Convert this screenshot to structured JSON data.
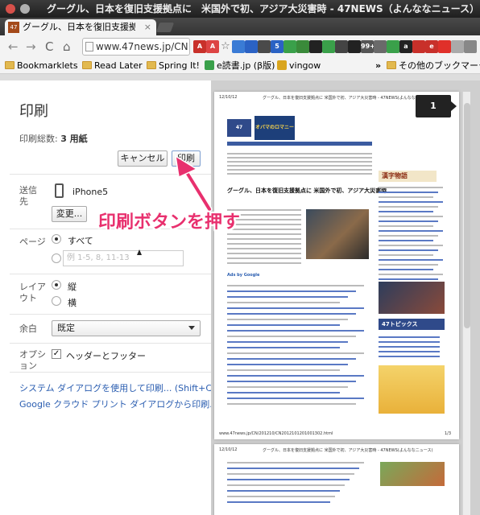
{
  "window": {
    "title": "グーグル、日本を復旧支援拠点に　米国外で初、アジア大災害時 - 47NEWS（よんななニュース）"
  },
  "tab": {
    "favicon": "47",
    "title": "グーグル、日本を復旧支援拠",
    "close": "×"
  },
  "toolbar": {
    "back": "←",
    "forward": "→",
    "reload": "C",
    "home": "⌂",
    "url": "www.47news.jp/CN",
    "extensions": [
      "A",
      "A",
      "☆",
      "",
      "",
      "",
      "5",
      "",
      "",
      "",
      "",
      "",
      "",
      "99+",
      "",
      "",
      "a",
      "",
      "e",
      "",
      "",
      "",
      "⚡"
    ]
  },
  "bookmarks": {
    "items": [
      "Bookmarklets",
      "Read Later",
      "Spring It!",
      "e読書.jp (β版)",
      "vingow"
    ],
    "more": "»",
    "other": "その他のブックマーク"
  },
  "print": {
    "title": "印刷",
    "total_label": "印刷総数: ",
    "total_value": "3 用紙",
    "cancel": "キャンセル",
    "print": "印刷",
    "destination_label": "送信先",
    "destination_name": "iPhone5",
    "change": "変更...",
    "pages_label": "ページ",
    "pages_all": "すべて",
    "pages_placeholder": "例 1-5, 8, 11-13",
    "layout_label": "レイアウト",
    "layout_portrait": "縦",
    "layout_landscape": "横",
    "margin_label": "余白",
    "margin_value": "既定",
    "options_label": "オプション",
    "header_footer": "ヘッダーとフッター",
    "system_dialog_link": "システム ダイアログを使用して印刷... (Shift+Ctrl+P)",
    "cloud_print_link": "Google クラウド プリント ダイアログから印刷..."
  },
  "annotation": {
    "text": "印刷ボタンを押す"
  },
  "preview": {
    "page_number": "1",
    "page1_date": "12/10/12",
    "page1_header": "グーグル、日本を復旧支援拠点に 米国外で初、アジア大災害時 - 47NEWS(よんななニュース)",
    "page1_headline": "グーグル、日本を復旧支援拠点に 米国外で初、アジア大災害時",
    "page1_footer_url": "www.47news.jp/CN/201210/CN2012101201001302.html",
    "page1_footer_num": "1/3",
    "page2_date": "12/10/12",
    "page2_header": "グーグル、日本を復旧支援拠点に 米国外で初、アジア大災害時 - 47NEWS(よんななニュース)",
    "logo_text": "47 NEWS",
    "banner_text": "オバマのロマニー",
    "side_title": "漢字物語",
    "side_badge": "47トピックス",
    "ads_label": "Ads by Google"
  },
  "colors": {
    "accent_pink": "#e8306e",
    "link_blue": "#2a5db0"
  }
}
